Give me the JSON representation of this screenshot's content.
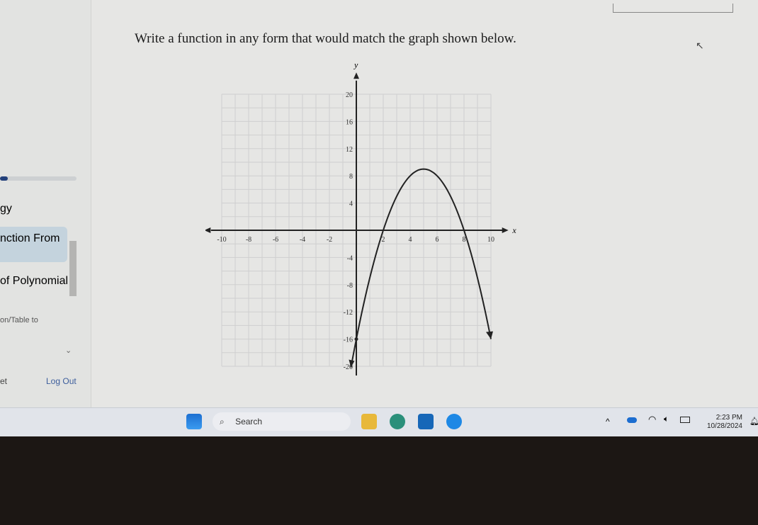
{
  "sidebar": {
    "progress": 0.1,
    "items": [
      {
        "label": "gy"
      },
      {
        "label": "nction From"
      },
      {
        "label": "of Polynomial"
      },
      {
        "label": "on/Table to"
      }
    ],
    "footer_left": "et",
    "logout": "Log Out"
  },
  "question": {
    "title": "Write a function in any form that would match the graph shown below."
  },
  "chart_data": {
    "type": "line",
    "xlabel": "x",
    "ylabel": "y",
    "xlim": [
      -10,
      10
    ],
    "ylim": [
      -20,
      20
    ],
    "xticks": [
      "-10",
      "-8",
      "-6",
      "-4",
      "-2",
      "2",
      "4",
      "6",
      "8",
      "10"
    ],
    "xtick_values": [
      -10,
      -8,
      -6,
      -4,
      -2,
      2,
      4,
      6,
      8,
      10
    ],
    "yticks": [
      "20",
      "16",
      "12",
      "8",
      "4",
      "-4",
      "-8",
      "-12",
      "-16",
      "-20"
    ],
    "ytick_values": [
      20,
      16,
      12,
      8,
      4,
      -4,
      -8,
      -12,
      -16,
      -20
    ],
    "grid": true,
    "series": [
      {
        "function": "-(x-2)(x-8)",
        "x_range": [
          -0.4,
          10
        ],
        "roots": [
          2,
          8
        ],
        "vertex": [
          5,
          9
        ],
        "y_intercept": -16,
        "marked_points": [
          [
            0,
            -16
          ]
        ]
      }
    ]
  },
  "taskbar": {
    "search": "Search",
    "time": "2:23 PM",
    "date": "10/28/2024"
  }
}
